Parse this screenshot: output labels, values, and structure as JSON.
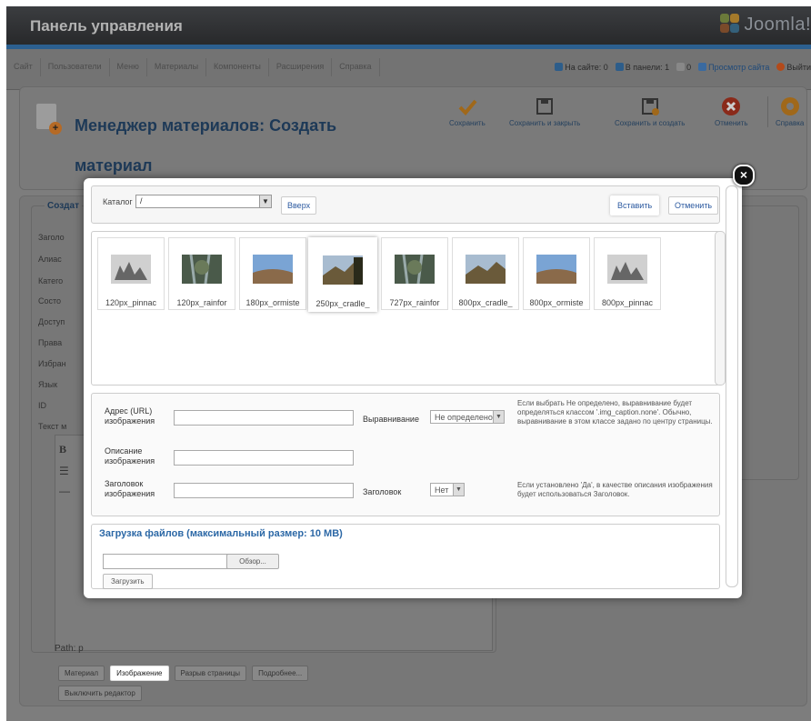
{
  "header": {
    "title": "Панель управления",
    "logo": "Joomla!"
  },
  "menu": [
    "Сайт",
    "Пользователи",
    "Меню",
    "Материалы",
    "Компоненты",
    "Расширения",
    "Справка"
  ],
  "status": {
    "site": "На сайте: 0",
    "panel": "В панели: 1",
    "messages": "0",
    "view_site": "Просмотр сайта",
    "logout": "Выйти"
  },
  "page": {
    "title_line1": "Менеджер материалов: Создать",
    "title_line2": "материал"
  },
  "toolbar": {
    "save": "Сохранить",
    "save_close": "Сохранить и закрыть",
    "save_new": "Сохранить и создать",
    "cancel": "Отменить",
    "help": "Справка"
  },
  "form": {
    "legend": "Создат",
    "labels": [
      "Заголо",
      "Алиас",
      "Катего",
      "Состо",
      "Доступ",
      "Права",
      "Избран",
      "Язык",
      "ID",
      "Текст м"
    ],
    "path": "Path: p",
    "buttons": [
      "Материал",
      "Изображение",
      "Разрыв страницы",
      "Подробнее..."
    ],
    "toggle": "Выключить редактор"
  },
  "modal": {
    "catalog_label": "Каталог",
    "catalog_value": "/",
    "up": "Вверх",
    "insert": "Вставить",
    "cancel": "Отменить",
    "thumbs": [
      {
        "label": "120px_pinnac",
        "img": "pinnacles"
      },
      {
        "label": "120px_rainfor",
        "img": "rainforest"
      },
      {
        "label": "180px_ormiste",
        "img": "ormiston"
      },
      {
        "label": "250px_cradle_",
        "img": "cradle"
      },
      {
        "label": "727px_rainfor",
        "img": "rainforest"
      },
      {
        "label": "800px_cradle_",
        "img": "cradle"
      },
      {
        "label": "800px_ormiste",
        "img": "ormiston"
      },
      {
        "label": "800px_pinnac",
        "img": "pinnacles"
      }
    ],
    "selected_index": 3,
    "fields": {
      "url_label_1": "Адрес (URL)",
      "url_label_2": "изображения",
      "desc_label_1": "Описание",
      "desc_label_2": "изображения",
      "title_label_1": "Заголовок",
      "title_label_2": "изображения",
      "align_label": "Выравнивание",
      "align_value": "Не определено",
      "caption_label": "Заголовок",
      "caption_value": "Нет"
    },
    "help_align": "Если выбрать Не определено, выравнивание будет определяться классом '.img_caption.none'. Обычно, выравнивание в этом классе задано по центру страницы.",
    "help_caption": "Если установлено 'Да', в качестве описания изображения будет использоваться Заголовок.",
    "upload": {
      "legend": "Загрузка файлов (максимальный размер: 10 MB)",
      "browse": "Обзор...",
      "upload_btn": "Загрузить"
    }
  }
}
